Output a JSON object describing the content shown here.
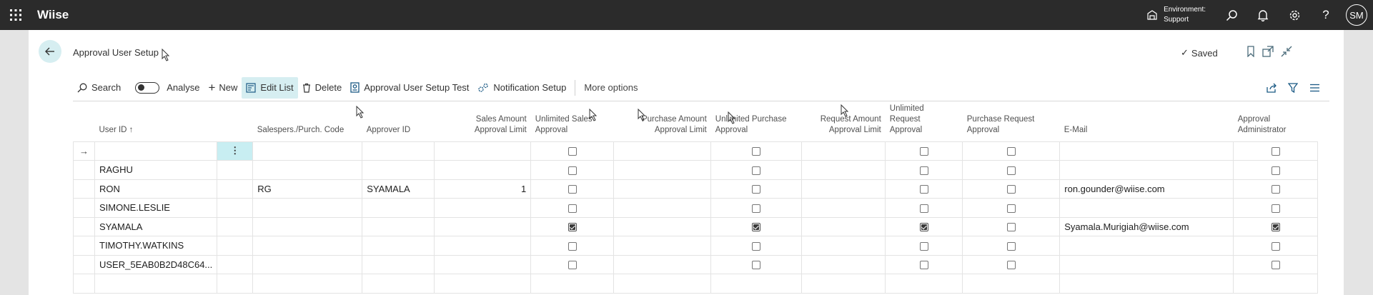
{
  "topbar": {
    "app_name": "Wiise",
    "environment_label": "Environment:",
    "environment_value": "Support",
    "avatar_initials": "SM"
  },
  "page": {
    "title": "Approval User Setup",
    "saved_status": "Saved"
  },
  "actions": {
    "search": "Search",
    "analyse": "Analyse",
    "new": "New",
    "edit_list": "Edit List",
    "delete": "Delete",
    "approval_test": "Approval User Setup Test",
    "notification_setup": "Notification Setup",
    "more_options": "More options"
  },
  "columns": {
    "user_id": "User ID ↑",
    "salespers": "Salespers./Purch. Code",
    "approver_id": "Approver ID",
    "sales_amount_1": "Sales Amount",
    "sales_amount_2": "Approval Limit",
    "unl_sales_1": "Unlimited Sales",
    "unl_sales_2": "Approval",
    "purch_amount_1": "Purchase Amount",
    "purch_amount_2": "Approval Limit",
    "unl_purch_1": "Unlimited Purchase",
    "unl_purch_2": "Approval",
    "req_amount_1": "Request Amount",
    "req_amount_2": "Approval Limit",
    "unl_req_1": "Unlimited",
    "unl_req_2": "Request",
    "unl_req_3": "Approval",
    "purch_req_1": "Purchase Request",
    "purch_req_2": "Approval",
    "email": "E-Mail",
    "admin_1": "Approval",
    "admin_2": "Administrator"
  },
  "rows": [
    {
      "user_id": "",
      "salespers": "",
      "approver_id": "",
      "sales_limit": "",
      "email": "",
      "unl_sales": false,
      "unl_purch": false,
      "unl_req": false,
      "purch_req": false,
      "admin": false
    },
    {
      "user_id": "RAGHU",
      "salespers": "",
      "approver_id": "",
      "sales_limit": "",
      "email": "",
      "unl_sales": false,
      "unl_purch": false,
      "unl_req": false,
      "purch_req": false,
      "admin": false
    },
    {
      "user_id": "RON",
      "salespers": "RG",
      "approver_id": "SYAMALA",
      "sales_limit": "1",
      "email": "ron.gounder@wiise.com",
      "unl_sales": false,
      "unl_purch": false,
      "unl_req": false,
      "purch_req": false,
      "admin": false
    },
    {
      "user_id": "SIMONE.LESLIE",
      "salespers": "",
      "approver_id": "",
      "sales_limit": "",
      "email": "",
      "unl_sales": false,
      "unl_purch": false,
      "unl_req": false,
      "purch_req": false,
      "admin": false
    },
    {
      "user_id": "SYAMALA",
      "salespers": "",
      "approver_id": "",
      "sales_limit": "",
      "email": "Syamala.Murigiah@wiise.com",
      "unl_sales": true,
      "unl_purch": true,
      "unl_req": true,
      "purch_req": false,
      "admin": true
    },
    {
      "user_id": "TIMOTHY.WATKINS",
      "salespers": "",
      "approver_id": "",
      "sales_limit": "",
      "email": "",
      "unl_sales": false,
      "unl_purch": false,
      "unl_req": false,
      "purch_req": false,
      "admin": false
    },
    {
      "user_id": "USER_5EAB0B2D48C64...",
      "salespers": "",
      "approver_id": "",
      "sales_limit": "",
      "email": "",
      "unl_sales": false,
      "unl_purch": false,
      "unl_req": false,
      "purch_req": false,
      "admin": false
    }
  ]
}
